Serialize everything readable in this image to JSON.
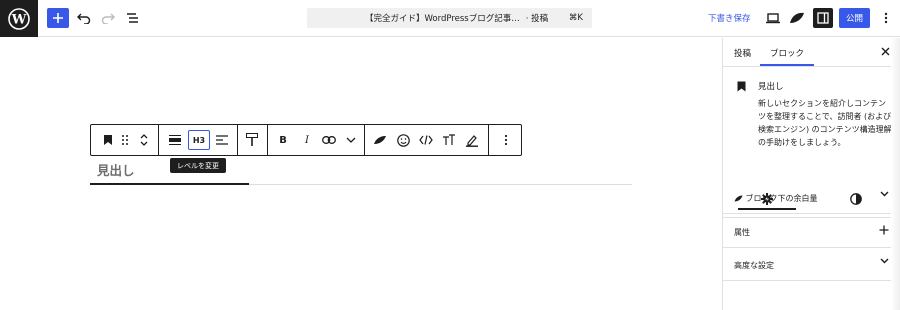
{
  "topbar": {
    "document_title": "【完全ガイド】WordPressブログ記事…",
    "document_type": "· 投稿",
    "shortcut": "⌘K",
    "save_draft_label": "下書き保存",
    "publish_label": "公開"
  },
  "toolbar": {
    "heading_level_label": "H3",
    "tooltip": "レベルを変更"
  },
  "editor": {
    "heading_placeholder": "見出し"
  },
  "sidebar": {
    "tabs": [
      "投稿",
      "ブロック"
    ],
    "active_tab": "ブロック",
    "block_name": "見出し",
    "block_description": "新しいセクションを紹介しコンテンツを整理することで、訪問者 (および検索エンジン) のコンテンツ構造理解の手助けをしましょう。",
    "panels": [
      {
        "label": "ブロック下の余白量",
        "control": "chevron-down"
      },
      {
        "label": "属性",
        "control": "plus"
      },
      {
        "label": "高度な設定",
        "control": "chevron-down"
      }
    ]
  },
  "colors": {
    "accent": "#3858e9",
    "dark": "#1e1e1e"
  }
}
